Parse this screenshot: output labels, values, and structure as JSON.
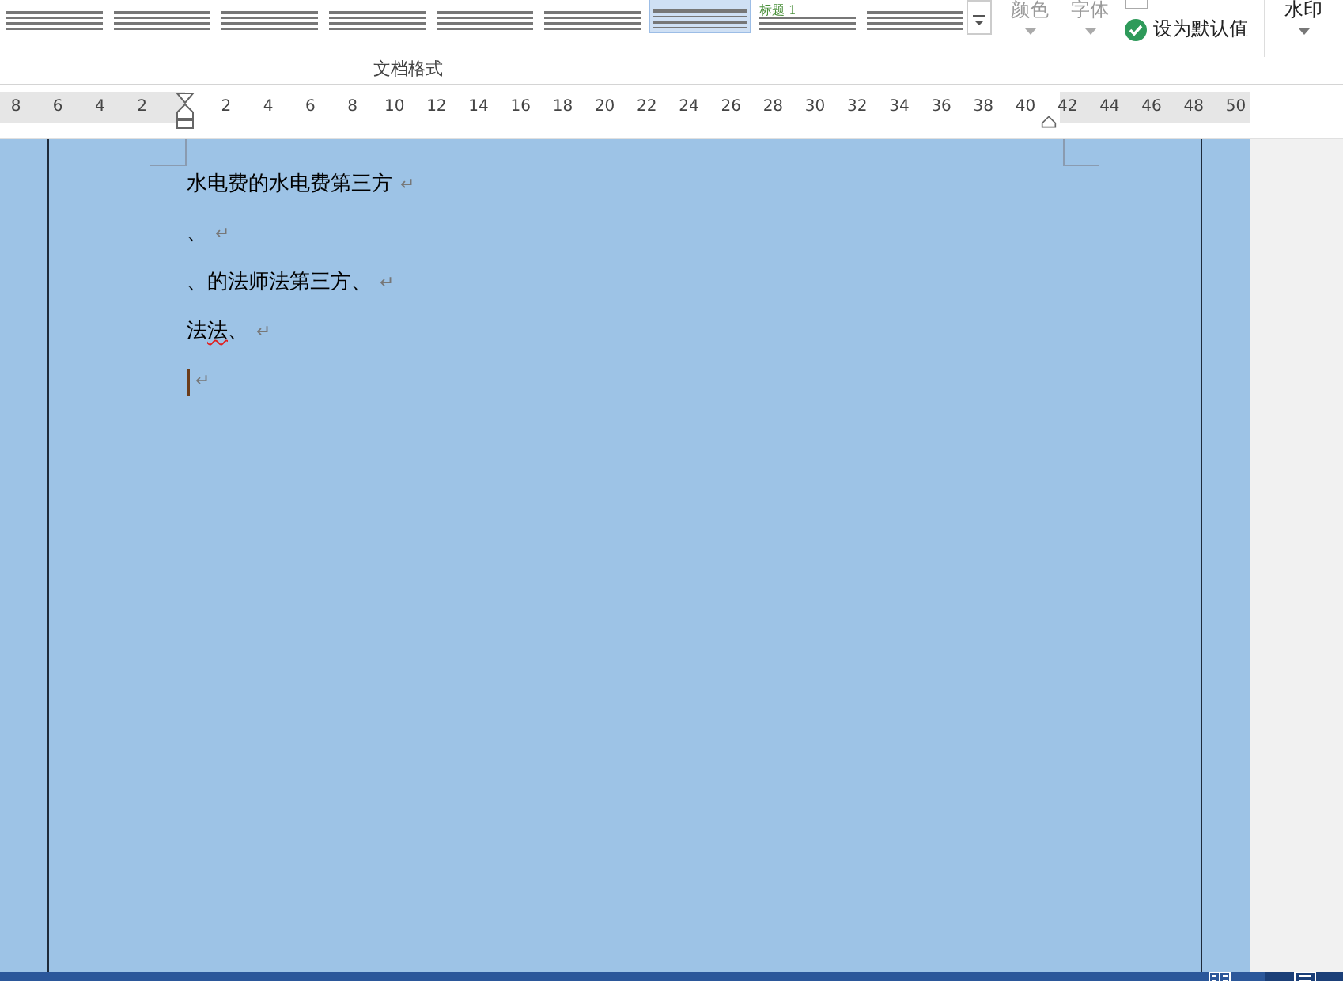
{
  "ribbon": {
    "gallery": {
      "thumbnails": [
        {
          "selected": false
        },
        {
          "selected": false
        },
        {
          "selected": false
        },
        {
          "selected": false
        },
        {
          "selected": false
        },
        {
          "selected": false
        },
        {
          "selected": true
        },
        {
          "selected": false,
          "heading": "标题 1"
        },
        {
          "selected": false
        }
      ],
      "options": [
        {
          "label": "颜色",
          "disabled": true
        },
        {
          "label": "字体",
          "disabled": true
        }
      ],
      "effects_checked": false,
      "set_default": "设为默认值",
      "group_label": "文档格式"
    },
    "watermark": {
      "label": "水印"
    }
  },
  "ruler": {
    "left_labels": [
      "8",
      "6",
      "4",
      "2"
    ],
    "middle_labels": [
      "2",
      "4",
      "6",
      "8",
      "10",
      "12",
      "14",
      "16",
      "18",
      "20",
      "22",
      "24",
      "26",
      "28",
      "30",
      "32",
      "34",
      "36",
      "38",
      "40"
    ],
    "right_labels": [
      "42",
      "44",
      "46",
      "48",
      "50"
    ]
  },
  "document": {
    "paragraphs": [
      {
        "segments": [
          {
            "text": "水电费的水电费第三方",
            "spelling_error": false
          }
        ],
        "mark": "↵"
      },
      {
        "segments": [
          {
            "text": "、",
            "spelling_error": false
          }
        ],
        "mark": "↵"
      },
      {
        "segments": [
          {
            "text": "、的法师法第三方、",
            "spelling_error": false
          }
        ],
        "mark": "↵"
      },
      {
        "segments": [
          {
            "text": "法",
            "spelling_error": false
          },
          {
            "text": "法",
            "spelling_error": true
          },
          {
            "text": "、",
            "spelling_error": false
          }
        ],
        "mark": "↵"
      },
      {
        "mark": "↵",
        "cursor": true
      }
    ]
  },
  "status_bar": {
    "views": [
      {
        "selected": false
      },
      {
        "selected": true
      }
    ]
  }
}
